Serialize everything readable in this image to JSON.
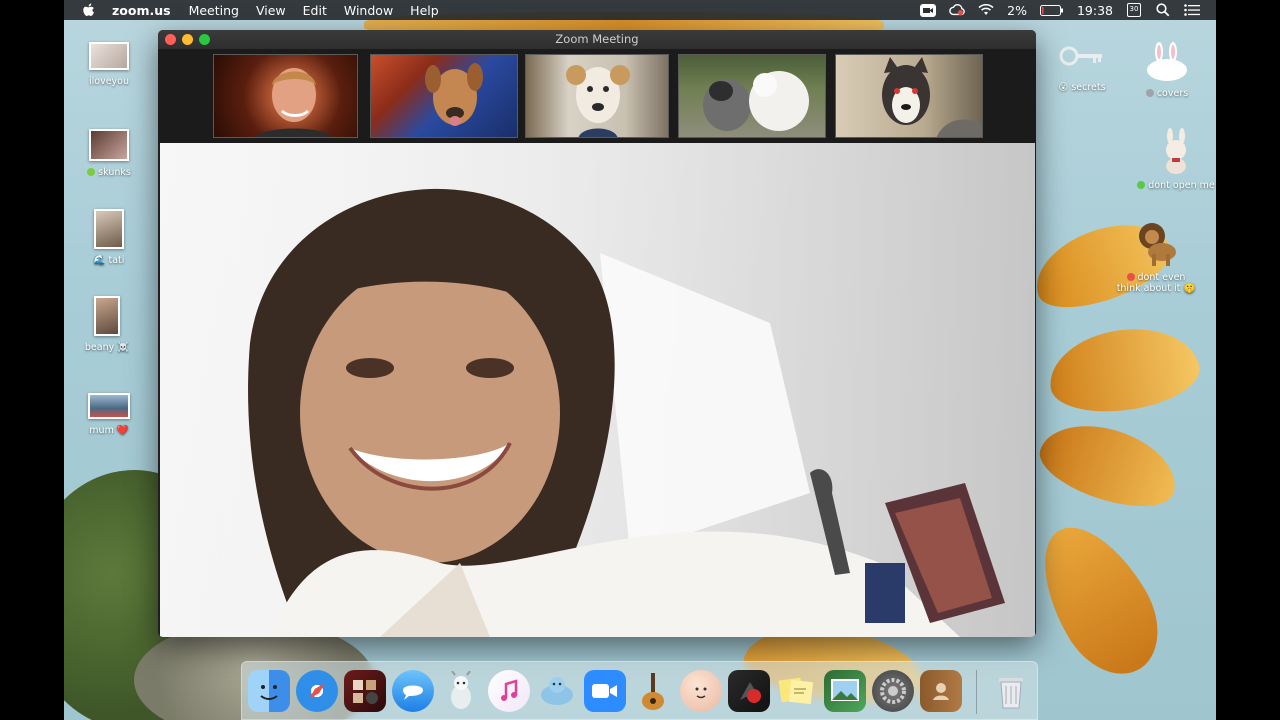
{
  "menubar": {
    "app_name": "zoom.us",
    "menus": [
      "Meeting",
      "View",
      "Edit",
      "Window",
      "Help"
    ],
    "battery": "2%",
    "time": "19:38",
    "calendar_day": "30"
  },
  "zoom_window": {
    "title": "Zoom Meeting",
    "participants": [
      "participant-man",
      "participant-dog-brown",
      "participant-dog-white",
      "participant-dogs-grey-white",
      "participant-husky"
    ]
  },
  "desktop": {
    "left_icons": [
      {
        "label": "iloveyou"
      },
      {
        "label": "skunks",
        "tag_color": "#7ccc3f"
      },
      {
        "label": "tati",
        "prefix": "🌊"
      },
      {
        "label": "beany",
        "suffix": "☠️"
      },
      {
        "label": "mum",
        "suffix": "❤️"
      }
    ],
    "right_icons": [
      {
        "label": "secrets",
        "prefix": "😮"
      },
      {
        "label": "covers",
        "tag_color": "#a0a4a8"
      },
      {
        "label": "dont open me",
        "tag_color": "#5bc948"
      },
      {
        "label_line1": "dont even",
        "label_line2": "think about it",
        "suffix": "🤫",
        "tag_color": "#e9504a"
      }
    ]
  },
  "dock": {
    "apps": [
      "Finder",
      "Safari",
      "Photo Booth",
      "Messages",
      "Cyberduck",
      "iTunes",
      "Sequel",
      "Zoom",
      "GarageBand",
      "Face",
      "Sketch Recorder",
      "Stickies",
      "Preview",
      "System Preferences",
      "Contacts",
      "Trash"
    ]
  }
}
